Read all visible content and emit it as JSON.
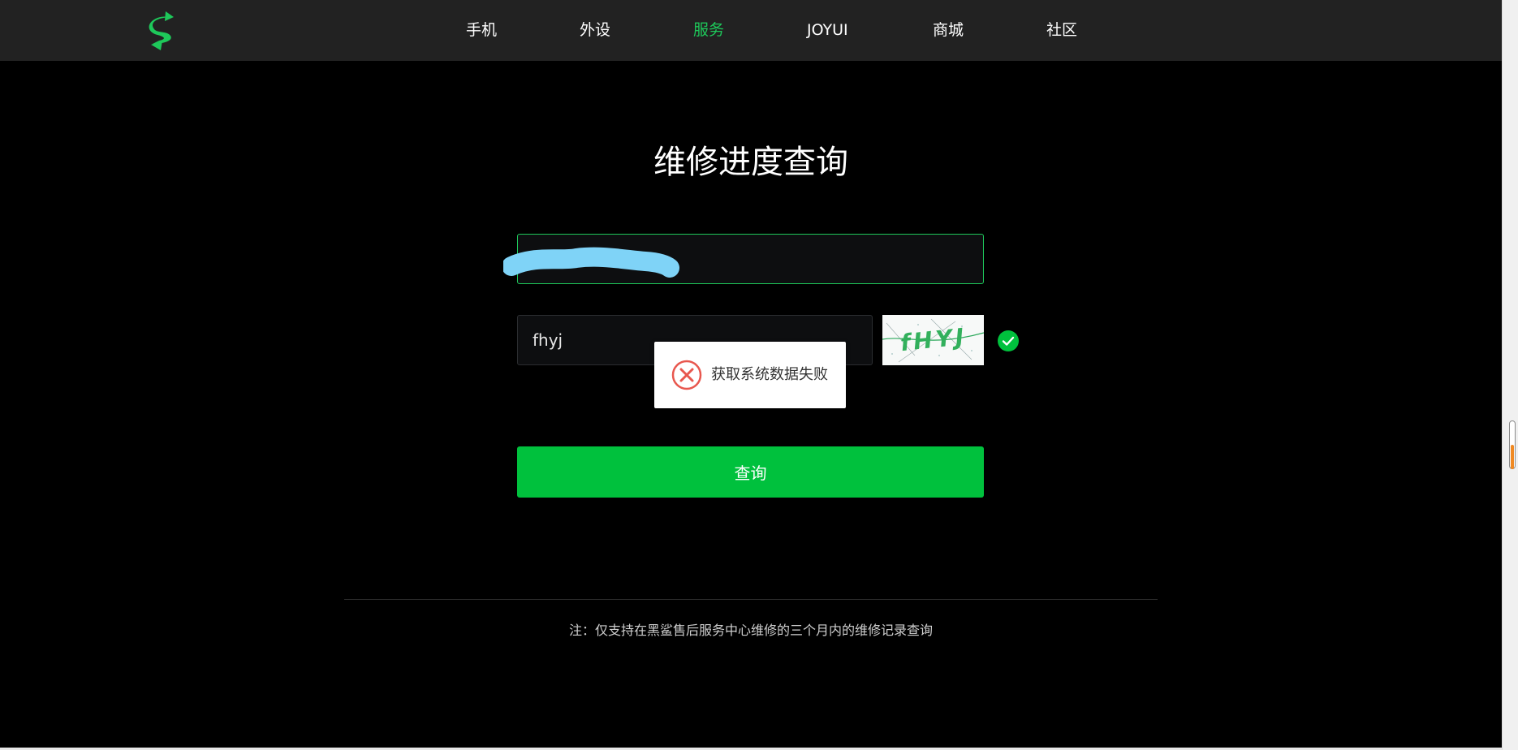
{
  "nav": {
    "items": [
      {
        "label": "手机"
      },
      {
        "label": "外设"
      },
      {
        "label": "服务",
        "active": true
      },
      {
        "label": "JOYUI"
      },
      {
        "label": "商城"
      },
      {
        "label": "社区"
      }
    ],
    "active_color": "#1ec85a"
  },
  "logo": {
    "icon": "blackshark-logo-icon",
    "color": "#1ec85a"
  },
  "page": {
    "title": "维修进度查询"
  },
  "form": {
    "phone_value": "",
    "phone_redacted": true,
    "captcha_value": "fhyj",
    "captcha_image_text": "fHYJ",
    "captcha_valid": true,
    "submit_label": "查询",
    "submit_color": "#00c13d"
  },
  "toast": {
    "message": "获取系统数据失败",
    "icon": "error-circle-icon",
    "icon_color": "#e8574e"
  },
  "footer": {
    "note": "注：仅支持在黑鲨售后服务中心维修的三个月内的维修记录查询"
  }
}
